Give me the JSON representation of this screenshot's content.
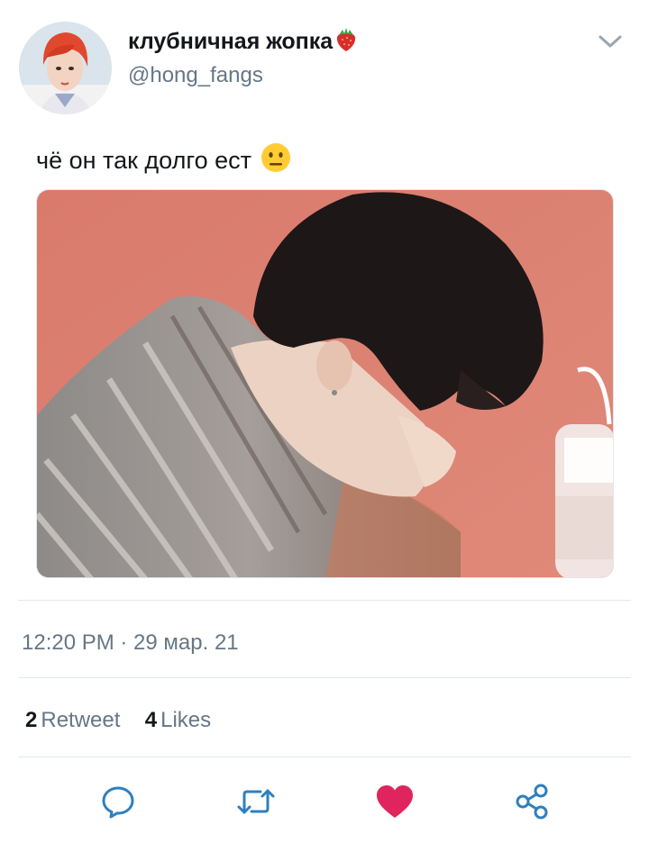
{
  "tweet": {
    "display_name": "клубничная жопка",
    "name_emoji": "strawberry",
    "handle": "@hong_fangs",
    "text": "чё он так долго ест",
    "text_emoji": "neutral-face",
    "timestamp": "12:20 PM · 29 мар. 21",
    "retweets": {
      "count": "2",
      "label": "Retweet"
    },
    "likes": {
      "count": "4",
      "label": "Likes"
    }
  },
  "actions": [
    {
      "name": "reply",
      "icon": "speech-bubble-icon"
    },
    {
      "name": "retweet",
      "icon": "retweet-arrows-icon"
    },
    {
      "name": "like",
      "icon": "heart-icon",
      "active": true
    },
    {
      "name": "share",
      "icon": "share-nodes-icon"
    }
  ],
  "colors": {
    "text": "#14171a",
    "secondary": "#657786",
    "divider": "#e1e8ed",
    "like": "#e0245e",
    "icon": "#1da1f2"
  }
}
